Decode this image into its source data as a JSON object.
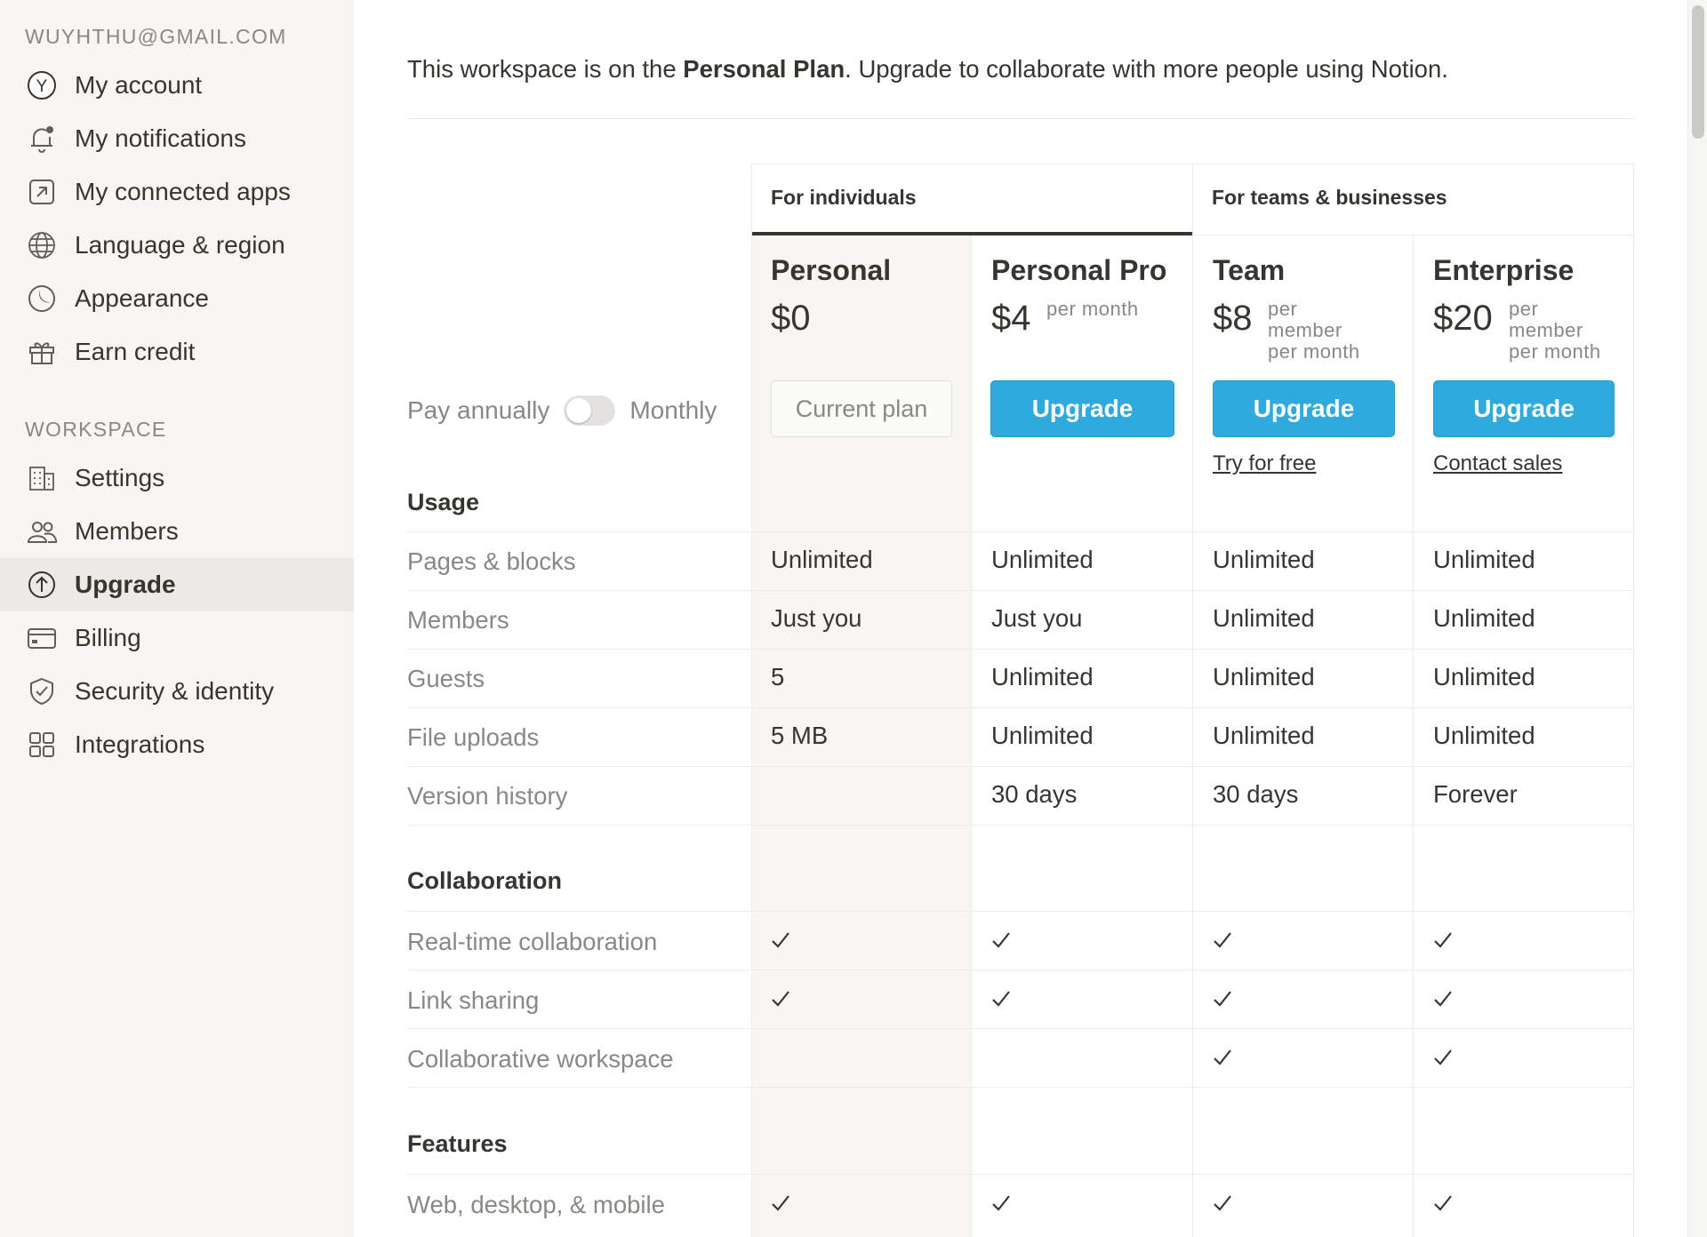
{
  "sidebar": {
    "account_email": "WUYHTHU@GMAIL.COM",
    "account_items": [
      {
        "label": "My account",
        "icon": "avatar-y-icon"
      },
      {
        "label": "My notifications",
        "icon": "bell-icon"
      },
      {
        "label": "My connected apps",
        "icon": "arrow-up-right-box-icon"
      },
      {
        "label": "Language & region",
        "icon": "globe-icon"
      },
      {
        "label": "Appearance",
        "icon": "moon-icon"
      },
      {
        "label": "Earn credit",
        "icon": "gift-icon"
      }
    ],
    "avatar_letter": "Y",
    "workspace_heading": "WORKSPACE",
    "workspace_items": [
      {
        "label": "Settings",
        "icon": "building-icon"
      },
      {
        "label": "Members",
        "icon": "people-icon"
      },
      {
        "label": "Upgrade",
        "icon": "arrow-up-circle-icon",
        "active": true
      },
      {
        "label": "Billing",
        "icon": "credit-card-icon"
      },
      {
        "label": "Security & identity",
        "icon": "shield-check-icon"
      },
      {
        "label": "Integrations",
        "icon": "grid-icon"
      }
    ]
  },
  "intro": {
    "prefix": "This workspace is on the ",
    "plan": "Personal Plan",
    "suffix": ". Upgrade to collaborate with more people using Notion."
  },
  "groups": {
    "individuals": "For individuals",
    "teams": "For teams & businesses"
  },
  "billing_toggle": {
    "left_label": "Pay annually",
    "right_label": "Monthly",
    "annual_selected": false
  },
  "plans": [
    {
      "name": "Personal",
      "price": "$0",
      "unit": "",
      "button": "Current plan",
      "current": true,
      "link": ""
    },
    {
      "name": "Personal Pro",
      "price": "$4",
      "unit": "per month",
      "button": "Upgrade",
      "current": false,
      "link": ""
    },
    {
      "name": "Team",
      "price": "$8",
      "unit": "per\nmember\nper month",
      "button": "Upgrade",
      "current": false,
      "link": "Try for free"
    },
    {
      "name": "Enterprise",
      "price": "$20",
      "unit": "per\nmember\nper month",
      "button": "Upgrade",
      "current": false,
      "link": "Contact sales"
    }
  ],
  "sections": [
    {
      "title": "Usage",
      "rows": [
        {
          "label": "Pages & blocks",
          "values": [
            "Unlimited",
            "Unlimited",
            "Unlimited",
            "Unlimited"
          ]
        },
        {
          "label": "Members",
          "values": [
            "Just you",
            "Just you",
            "Unlimited",
            "Unlimited"
          ]
        },
        {
          "label": "Guests",
          "values": [
            "5",
            "Unlimited",
            "Unlimited",
            "Unlimited"
          ]
        },
        {
          "label": "File uploads",
          "values": [
            "5 MB",
            "Unlimited",
            "Unlimited",
            "Unlimited"
          ]
        },
        {
          "label": "Version history",
          "values": [
            "",
            "30 days",
            "30 days",
            "Forever"
          ]
        }
      ]
    },
    {
      "title": "Collaboration",
      "rows": [
        {
          "label": "Real-time collaboration",
          "values": [
            true,
            true,
            true,
            true
          ]
        },
        {
          "label": "Link sharing",
          "values": [
            true,
            true,
            true,
            true
          ]
        },
        {
          "label": "Collaborative workspace",
          "values": [
            false,
            false,
            true,
            true
          ]
        }
      ]
    },
    {
      "title": "Features",
      "rows": [
        {
          "label": "Web, desktop, & mobile",
          "values": [
            true,
            true,
            true,
            true
          ]
        }
      ]
    }
  ],
  "colors": {
    "accent": "#2eaadc",
    "sidebar_bg": "#f7f6f3",
    "text": "#37352f",
    "muted": "#8a8883"
  }
}
